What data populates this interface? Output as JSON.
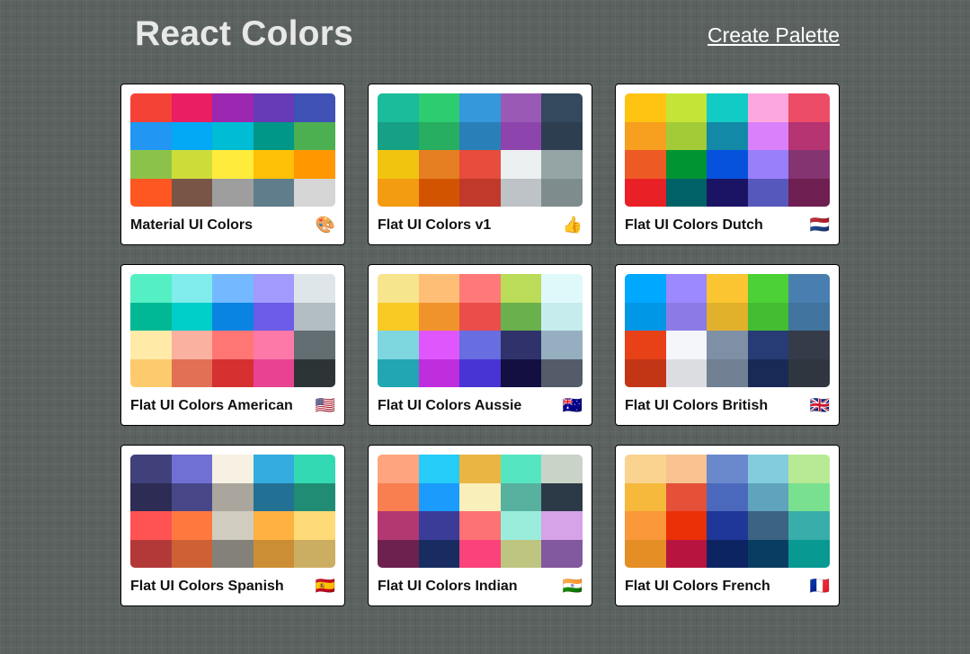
{
  "header": {
    "title": "React Colors",
    "create_label": "Create Palette"
  },
  "palettes": [
    {
      "name": "Material UI Colors",
      "emoji": "🎨",
      "colors": [
        "#f44336",
        "#e91e63",
        "#9c27b0",
        "#673ab7",
        "#3f51b5",
        "#2196f3",
        "#03a9f4",
        "#00bcd4",
        "#009688",
        "#4caf50",
        "#8bc34a",
        "#cddc39",
        "#ffeb3b",
        "#ffc107",
        "#ff9800",
        "#ff5722",
        "#795548",
        "#9e9e9e",
        "#607d8b",
        "#d5d5d5"
      ]
    },
    {
      "name": "Flat UI Colors v1",
      "emoji": "👍",
      "colors": [
        "#1abc9c",
        "#2ecc71",
        "#3498db",
        "#9b59b6",
        "#34495e",
        "#16a085",
        "#27ae60",
        "#2980b9",
        "#8e44ad",
        "#2c3e50",
        "#f1c40f",
        "#e67e22",
        "#e74c3c",
        "#ecf0f1",
        "#95a5a6",
        "#f39c12",
        "#d35400",
        "#c0392b",
        "#bdc3c7",
        "#7f8c8d"
      ]
    },
    {
      "name": "Flat UI Colors Dutch",
      "emoji": "🇳🇱",
      "colors": [
        "#ffc312",
        "#c4e538",
        "#12cbc4",
        "#fda7df",
        "#ed4c67",
        "#f79f1f",
        "#a3cb38",
        "#1289a7",
        "#d980fa",
        "#b53471",
        "#ee5a24",
        "#009432",
        "#0652dd",
        "#9980fa",
        "#833471",
        "#ea2027",
        "#006266",
        "#1b1464",
        "#5758bb",
        "#6f1e51"
      ]
    },
    {
      "name": "Flat UI Colors American",
      "emoji": "🇺🇸",
      "colors": [
        "#55efc4",
        "#81ecec",
        "#74b9ff",
        "#a29bfe",
        "#dfe6e9",
        "#00b894",
        "#00cec9",
        "#0984e3",
        "#6c5ce7",
        "#b2bec3",
        "#ffeaa7",
        "#fab1a0",
        "#ff7675",
        "#fd79a8",
        "#636e72",
        "#fdcb6e",
        "#e17055",
        "#d63031",
        "#e84393",
        "#2d3436"
      ]
    },
    {
      "name": "Flat UI Colors Aussie",
      "emoji": "🇦🇺",
      "colors": [
        "#f6e58d",
        "#ffbe76",
        "#ff7979",
        "#badc58",
        "#dff9fb",
        "#f9ca24",
        "#f0932b",
        "#eb4d4b",
        "#6ab04c",
        "#c7ecee",
        "#7ed6df",
        "#e056fd",
        "#686de0",
        "#30336b",
        "#95afc0",
        "#22a6b3",
        "#be2edd",
        "#4834d4",
        "#130f40",
        "#535c68"
      ]
    },
    {
      "name": "Flat UI Colors British",
      "emoji": "🇬🇧",
      "colors": [
        "#00a8ff",
        "#9c88ff",
        "#fbc531",
        "#4cd137",
        "#487eb0",
        "#0097e6",
        "#8c7ae6",
        "#e1b12c",
        "#44bd32",
        "#40739e",
        "#e84118",
        "#f5f6fa",
        "#7f8fa6",
        "#273c75",
        "#353b48",
        "#c23616",
        "#dcdde1",
        "#718093",
        "#192a56",
        "#2f3640"
      ]
    },
    {
      "name": "Flat UI Colors Spanish",
      "emoji": "🇪🇸",
      "colors": [
        "#40407a",
        "#706fd3",
        "#f7f1e3",
        "#34ace0",
        "#33d9b2",
        "#2c2c54",
        "#474787",
        "#aaa69d",
        "#227093",
        "#218c74",
        "#ff5252",
        "#ff793f",
        "#d1ccc0",
        "#ffb142",
        "#ffda79",
        "#b33939",
        "#cd6133",
        "#84817a",
        "#cc8e35",
        "#ccae62"
      ]
    },
    {
      "name": "Flat UI Colors Indian",
      "emoji": "🇮🇳",
      "colors": [
        "#fea47f",
        "#25ccf7",
        "#eab543",
        "#55e6c1",
        "#cad3c8",
        "#f97f51",
        "#1b9cfc",
        "#f8efba",
        "#58b19f",
        "#2c3a47",
        "#b33771",
        "#3b3b98",
        "#fd7272",
        "#9aecdb",
        "#d6a2e8",
        "#6d214f",
        "#182c61",
        "#fc427b",
        "#bdc581",
        "#82589f"
      ]
    },
    {
      "name": "Flat UI Colors French",
      "emoji": "🇫🇷",
      "colors": [
        "#fad390",
        "#f8c291",
        "#6a89cc",
        "#82ccdd",
        "#b8e994",
        "#f6b93b",
        "#e55039",
        "#4a69bd",
        "#60a3bc",
        "#78e08f",
        "#fa983a",
        "#eb2f06",
        "#1e3799",
        "#3c6382",
        "#38ada9",
        "#e58e26",
        "#b71540",
        "#0c2461",
        "#0a3d62",
        "#079992"
      ]
    }
  ]
}
